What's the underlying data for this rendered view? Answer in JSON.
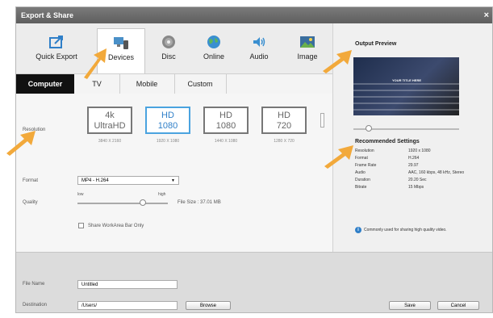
{
  "window": {
    "title": "Export & Share",
    "close_glyph": "×"
  },
  "tabs": [
    {
      "label": "Quick Export",
      "icon": "share-icon"
    },
    {
      "label": "Devices",
      "icon": "devices-icon",
      "selected": true
    },
    {
      "label": "Disc",
      "icon": "disc-icon"
    },
    {
      "label": "Online",
      "icon": "globe-icon"
    },
    {
      "label": "Audio",
      "icon": "audio-icon"
    },
    {
      "label": "Image",
      "icon": "image-icon"
    }
  ],
  "subtabs": [
    {
      "label": "Computer",
      "selected": true
    },
    {
      "label": "TV"
    },
    {
      "label": "Mobile"
    },
    {
      "label": "Custom"
    }
  ],
  "settings": {
    "resolution_label": "Resolution",
    "resolutions": [
      {
        "line1": "4k",
        "line2": "UltraHD",
        "dims": "3840 X 2160"
      },
      {
        "line1": "HD",
        "line2": "1080",
        "dims": "1920 X 1080",
        "selected": true
      },
      {
        "line1": "HD",
        "line2": "1080",
        "dims": "1440 X 1080"
      },
      {
        "line1": "HD",
        "line2": "720",
        "dims": "1280 X 720"
      }
    ],
    "format_label": "Format",
    "format_value": "MP4 - H.264",
    "quality_label": "Quality",
    "quality_low": "low",
    "quality_high": "high",
    "quality_level": 0.72,
    "file_size": "File Size :  37.01 MB",
    "share_checkbox": "Share WorkArea Bar Only"
  },
  "preview": {
    "title": "Output Preview",
    "thumb_text": "YOUR TITLE HERE",
    "rec_title": "Recommended Settings",
    "rows": [
      {
        "k": "Resolution",
        "v": "1920 x 1080"
      },
      {
        "k": "Format",
        "v": "H.264"
      },
      {
        "k": "Frame Rate",
        "v": "29.97"
      },
      {
        "k": "Audio",
        "v": "AAC, 160 kbps, 48 kHz, Stereo"
      },
      {
        "k": "Duration",
        "v": "20.20 Sec"
      },
      {
        "k": "Bitrate",
        "v": "15 Mbps"
      }
    ],
    "info_text": "Commonly used for sharing high quality video.",
    "accent": "#2f7fc8"
  },
  "bottom": {
    "filename_label": "File Name",
    "filename_value": "Untitled",
    "destination_label": "Destination",
    "destination_value": "/Users/",
    "browse_label": "Browse",
    "save_label": "Save",
    "cancel_label": "Cancel"
  }
}
